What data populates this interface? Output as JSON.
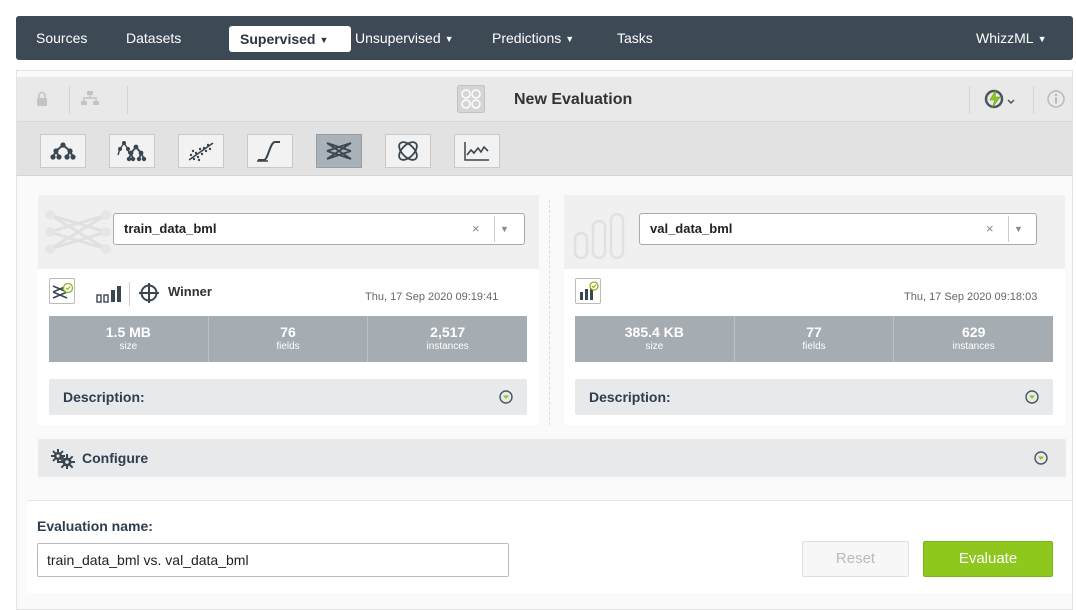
{
  "nav": {
    "sources": "Sources",
    "datasets": "Datasets",
    "supervised": "Supervised",
    "unsupervised": "Unsupervised",
    "predictions": "Predictions",
    "tasks": "Tasks",
    "whizzml": "WhizzML"
  },
  "titlebar": {
    "title": "New Evaluation"
  },
  "algo_icons": [
    "model-icon",
    "ensemble-icon",
    "linear-regression-icon",
    "logistic-regression-icon",
    "deepnet-icon",
    "fusion-icon",
    "timeseries-icon"
  ],
  "left_panel": {
    "selected": "train_data_bml",
    "clear": "×",
    "badge": "Winner",
    "date": "Thu, 17 Sep 2020 09:19:41",
    "stats": [
      {
        "value": "1.5 MB",
        "label": "size"
      },
      {
        "value": "76",
        "label": "fields"
      },
      {
        "value": "2,517",
        "label": "instances"
      }
    ],
    "description_label": "Description:"
  },
  "right_panel": {
    "selected": "val_data_bml",
    "clear": "×",
    "date": "Thu, 17 Sep 2020 09:18:03",
    "stats": [
      {
        "value": "385.4 KB",
        "label": "size"
      },
      {
        "value": "77",
        "label": "fields"
      },
      {
        "value": "629",
        "label": "instances"
      }
    ],
    "description_label": "Description:"
  },
  "configure": {
    "label": "Configure"
  },
  "evaluation": {
    "name_label": "Evaluation name:",
    "name_value": "train_data_bml vs. val_data_bml",
    "reset_label": "Reset",
    "evaluate_label": "Evaluate"
  },
  "colors": {
    "navbar": "#3d4a55",
    "accent_green": "#8ec81e",
    "stats_bg": "#a5adb3",
    "icon_green": "#8db817"
  }
}
